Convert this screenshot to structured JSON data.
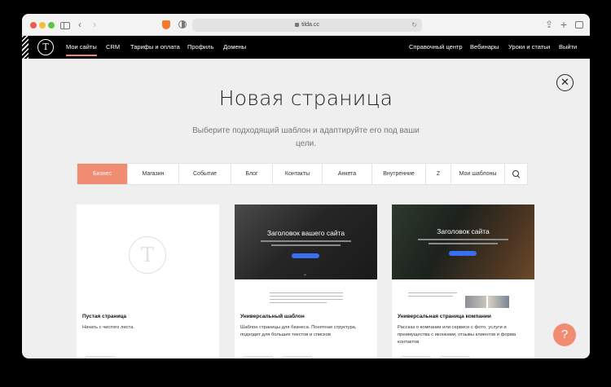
{
  "browser": {
    "url": "tilda.cc",
    "icons": [
      "sidebar-icon",
      "back-icon",
      "forward-icon",
      "brave-shield-icon",
      "privacy-icon",
      "lock-icon",
      "reload-icon",
      "share-icon",
      "new-tab-icon",
      "tabs-overview-icon"
    ]
  },
  "nav": {
    "logo": "T",
    "left": [
      "Мои сайты",
      "CRM",
      "Тарифы и оплата",
      "Профиль",
      "Домены"
    ],
    "right": [
      "Справочный центр",
      "Вебинары",
      "Уроки и статьи",
      "Выйти"
    ]
  },
  "main": {
    "title": "Новая страница",
    "subtitle": "Выберите подходящий шаблон и адаптируйте его под ваши цели.",
    "close": "✕"
  },
  "tabs": [
    "Бизнес",
    "Магазин",
    "Событие",
    "Блог",
    "Контакты",
    "Анкета",
    "Внутренние",
    "Z",
    "Мои шаблоны"
  ],
  "active_tab": "Бизнес",
  "cards": [
    {
      "title": "Пустая страница",
      "desc": "Начать с чистого листа.",
      "preview_logo": "T"
    },
    {
      "title": "Универсальный шаблон",
      "desc": "Шаблон страницы для бизнеса. Понятная структура, подходит для больших текстов и списков",
      "hero": "Заголовок вашего сайта"
    },
    {
      "title": "Универсальная страница компании",
      "desc": "Рассказ о компании или сервисе с фото, услуги и преимущества с иконками, отзывы клиентов и форма контактов",
      "hero": "Заголовок сайта"
    }
  ],
  "help": "?",
  "colors": {
    "accent": "#f08c71",
    "nav_bg": "#000000",
    "page_bg": "#efefef"
  }
}
